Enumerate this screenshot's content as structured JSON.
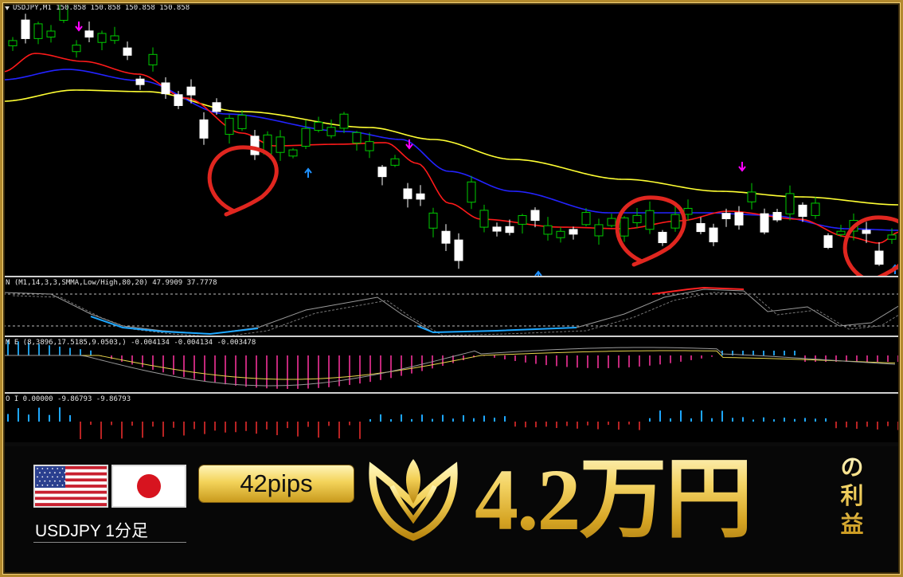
{
  "window": {
    "price_header": "USDJPY,M1  150.858 150.858 150.858 150.858"
  },
  "indicators": [
    {
      "label": "N (M1,14,3,3,SMMA,Low/High,80,20) 47.9909 37.7778"
    },
    {
      "label": "M  E (8,3896,17.5185,9.0503,) -0.004134 -0.004134 -0.003478"
    },
    {
      "label": "O  I 0.00000 -9.86793 -9.86793"
    }
  ],
  "colors": {
    "bull_candle": "#00cc00",
    "bear_candle": "#ffffff",
    "ma_fast": "#ff1a1a",
    "ma_mid": "#2323ff",
    "ma_slow": "#ffff33",
    "buy_arrow": "#1e90ff",
    "sell_arrow": "#ff00ff",
    "circle_mark": "#e0261f",
    "gold": "#f1cf58"
  },
  "banner": {
    "pair": "USDJPY 1分足",
    "pips": "42pips",
    "profit_amount": "4.2万円",
    "profit_suffix": "の利益"
  },
  "icons": {
    "flag_us": "us-flag-icon",
    "flag_jp": "jp-flag-icon",
    "logo": "gold-emblem-logo"
  }
}
